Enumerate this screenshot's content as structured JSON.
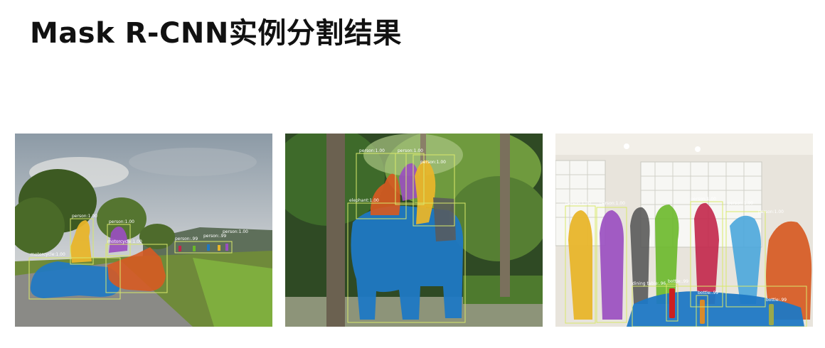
{
  "title": "Mask R-CNN实例分割结果",
  "mask_colors": {
    "blue": "#1f78c4",
    "yellow": "#e8b52a",
    "purple": "#9a4fc0",
    "orange": "#d65a22",
    "green": "#6ab82a",
    "crimson": "#c2264a",
    "red": "#cc2020",
    "gray": "#5a5a5a",
    "box": "#d8e86a"
  },
  "panels": [
    {
      "scene": "outdoor-road-motorcycles",
      "labels": [
        "person:1.00",
        "person:1.00",
        "motorcycle:1.00",
        "motorcycle:1.00",
        "person:.99",
        "person:.99",
        "person:1.00"
      ]
    },
    {
      "scene": "elephant-riders-forest",
      "labels": [
        "person:1.00",
        "person:1.00",
        "elephant:1.00",
        "person:1.00"
      ]
    },
    {
      "scene": "indoor-people-group",
      "labels": [
        "person:1.00",
        "person:1.00",
        "person:1.00",
        "person:1.00",
        "person:1.00",
        "dining table:.96",
        "bottle:.99",
        "bottle:.99",
        "bottle:.99"
      ]
    }
  ]
}
